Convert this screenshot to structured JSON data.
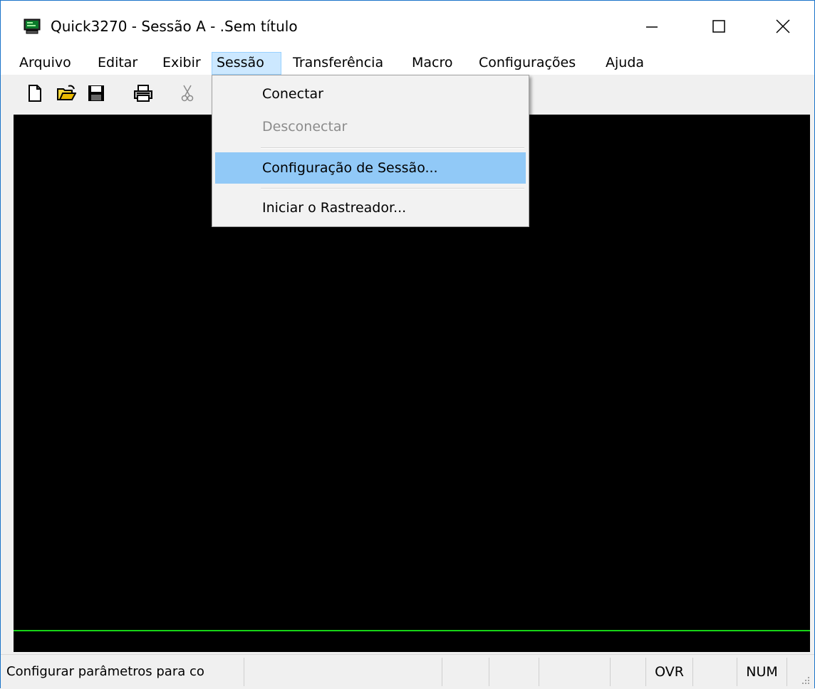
{
  "window": {
    "title": "Quick3270 - Sessão A - .Sem título",
    "icon": "terminal-monitor-icon",
    "controls": [
      "minimize-icon",
      "maximize-icon",
      "close-icon"
    ]
  },
  "menubar": {
    "items": [
      {
        "label": "Arquivo"
      },
      {
        "label": "Editar"
      },
      {
        "label": "Exibir"
      },
      {
        "label": "Sessão",
        "active": true
      },
      {
        "label": "Transferência"
      },
      {
        "label": "Macro"
      },
      {
        "label": "Configurações"
      },
      {
        "label": "Ajuda"
      }
    ]
  },
  "toolbar": {
    "icons": [
      "new-file-icon",
      "open-folder-icon",
      "save-icon",
      "print-icon",
      "cut-icon"
    ]
  },
  "session_menu": {
    "items": [
      {
        "label": "Conectar",
        "enabled": true
      },
      {
        "label": "Desconectar",
        "enabled": false
      },
      {
        "label": "Configuração de Sessão...",
        "enabled": true,
        "highlighted": true
      },
      {
        "label": "Iniciar o Rastreador...",
        "enabled": true
      }
    ]
  },
  "statusbar": {
    "message": "Configurar parâmetros para co",
    "ovr": "OVR",
    "num": "NUM"
  },
  "colors": {
    "terminal_bg": "#000000",
    "status_line": "#17d417",
    "menu_highlight": "#91c9f7",
    "menubar_active": "#cce8ff"
  }
}
